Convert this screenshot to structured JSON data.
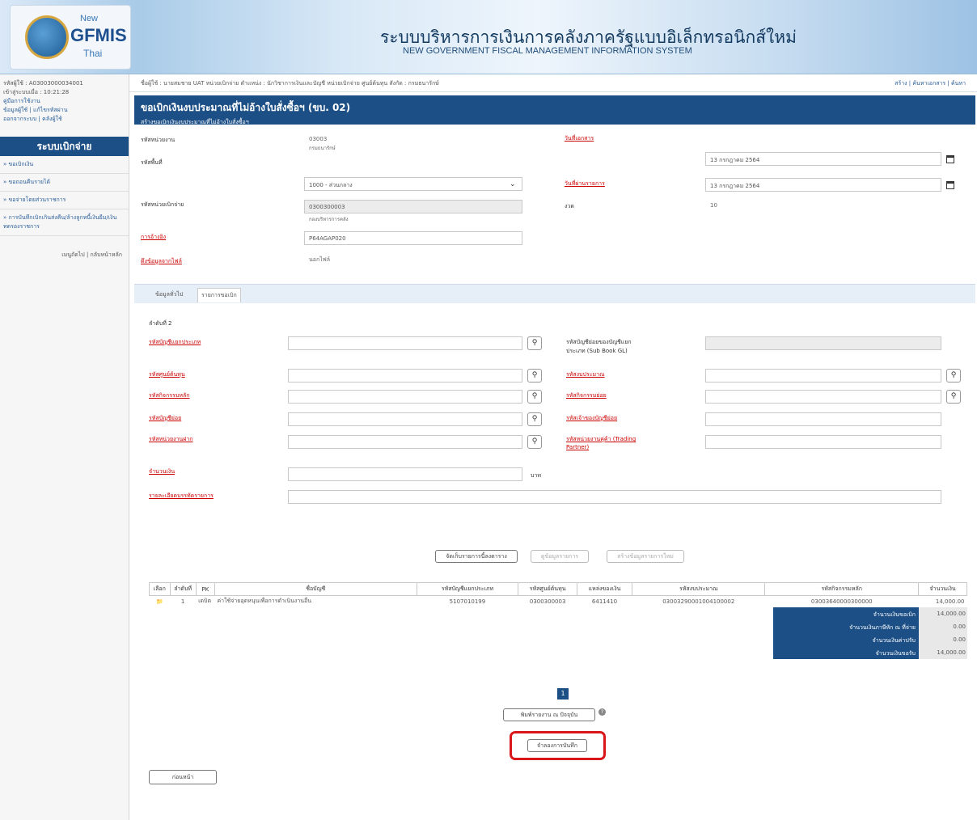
{
  "header": {
    "logo_new": "New",
    "logo_gfmis": "GFMIS",
    "logo_thai": "Thai",
    "title_th": "ระบบบริหารการเงินการคลังภาครัฐแบบอิเล็กทรอนิกส์ใหม่",
    "title_en": "NEW GOVERNMENT FISCAL MANAGEMENT INFORMATION SYSTEM"
  },
  "sidebar": {
    "user_id": "รหัสผู้ใช้ : A03003000034001",
    "login_time": "เข้าสู่ระบบเมื่อ : 10:21:28",
    "manual": "คู่มือการใช้งาน",
    "account_links": "ข้อมูลผู้ใช้ | แก้ไขรหัสผ่าน",
    "logout_links": "ออกจากระบบ | คลังผู้ใช้",
    "section_title": "ระบบเบิกจ่าย",
    "menu": [
      "» ขอเบิกเงิน",
      "» ขอถอนคืนรายได้",
      "» ขอจ่ายโดยส่วนราชการ",
      "» การบันทึกเบิกเกินส่งคืน/ล้างลูกหนี้เงินยืม/เงินทดรองราชการ"
    ],
    "bottom_links": "เมนูถัดไป | กลับหน้าหลัก"
  },
  "topbar": {
    "info": "ชื่อผู้ใช้ : นายสมชาย UAT หน่วยเบิกจ่าย   ตำแหน่ง : นักวิชาการเงินและบัญชี หน่วยเบิกจ่าย ศูนย์ต้นทุน   สังกัด : กรมธนารักษ์",
    "right_links": "สร้าง | ค้นหาเอกสาร | ค้นหา"
  },
  "title": {
    "main": "ขอเบิกเงินงบประมาณที่ไม่อ้างใบสั่งซื้อฯ (ขบ. 02)",
    "sub": "สร้างขอเบิกเงินงบประมาณที่ไม่อ้างใบสั่งซื้อฯ"
  },
  "form": {
    "agency_label": "รหัสหน่วยงาน",
    "agency_value": "03003",
    "agency_name": "กรมธนารักษ์",
    "area_label": "รหัสพื้นที่",
    "area_value": "1000 - ส่วนกลาง",
    "disb_label": "รหัสหน่วยเบิกจ่าย",
    "disb_value": "0300300003",
    "disb_name": "กองบริหารการคลัง",
    "ref_label": "การอ้างอิง",
    "ref_value": "P64AGAP020",
    "source_label": "ดึงข้อมูลจากไฟล์",
    "source_value": "นอกไฟล์",
    "doc_date_label": "วันที่เอกสาร",
    "doc_date_value": "13 กรกฎาคม 2564",
    "post_date_label": "วันที่ผ่านรายการ",
    "post_date_value": "13 กรกฎาคม 2564",
    "period_label": "งวด",
    "period_value": "10"
  },
  "tabs": [
    "ข้อมูลทั่วไป",
    "รายการขอเบิก"
  ],
  "item": {
    "seq_label": "ลำดับที่ 2",
    "gl_label": "รหัสบัญชีแยกประเภท",
    "subgl_label": "รหัสบัญชีย่อยของบัญชีแยกประเภท (Sub Book GL)",
    "cost_center_label": "รหัสศูนย์ต้นทุน",
    "budget_label": "รหัสงบประมาณ",
    "main_activity_label": "รหัสกิจกรรมหลัก",
    "sub_activity_label": "รหัสกิจกรรมย่อย",
    "sub_account_label": "รหัสบัญชีย่อย",
    "owner_label": "รหัสเจ้าของบัญชีย่อย",
    "deposit_label": "รหัสหน่วยงานฝาก",
    "trading_label": "รหัสหน่วยงานคู่ค้า (Trading Partner)",
    "amount_label": "จำนวนเงิน",
    "amount_unit": "บาท",
    "desc_label": "รายละเอียดบรรทัดรายการ"
  },
  "buttons": {
    "save_item": "จัดเก็บรายการนี้ลงตาราง",
    "view_list": "ดูข้อมูลรายการ",
    "new_item": "สร้างข้อมูลรายการใหม่",
    "print": "พิมพ์รายงาน ณ ปัจจุบัน",
    "simulate": "จำลองการบันทึก",
    "back": "ก่อนหน้า"
  },
  "table": {
    "headers": [
      "เลือก",
      "ลำดับที่",
      "PK",
      "ชื่อบัญชี",
      "รหัสบัญชีแยกประเภท",
      "รหัสศูนย์ต้นทุน",
      "แหล่งของเงิน",
      "รหัสงบประมาณ",
      "รหัสกิจกรรมหลัก",
      "จำนวนเงิน"
    ],
    "rows": [
      [
        "",
        "1",
        "เดบิต",
        "ค่าใช้จ่ายอุดหนุนเพื่อการดำเนินงานอื่น",
        "5107010199",
        "0300300003",
        "6411410",
        "03003290001004100002",
        "03003640000300000",
        "14,000.00"
      ]
    ]
  },
  "summary": [
    {
      "label": "จำนวนเงินขอเบิก",
      "value": "14,000.00"
    },
    {
      "label": "จำนวนเงินภาษีหัก ณ ที่จ่าย",
      "value": "0.00"
    },
    {
      "label": "จำนวนเงินค่าปรับ",
      "value": "0.00"
    },
    {
      "label": "จำนวนเงินขอรับ",
      "value": "14,000.00"
    }
  ],
  "pager": {
    "current": "1"
  }
}
